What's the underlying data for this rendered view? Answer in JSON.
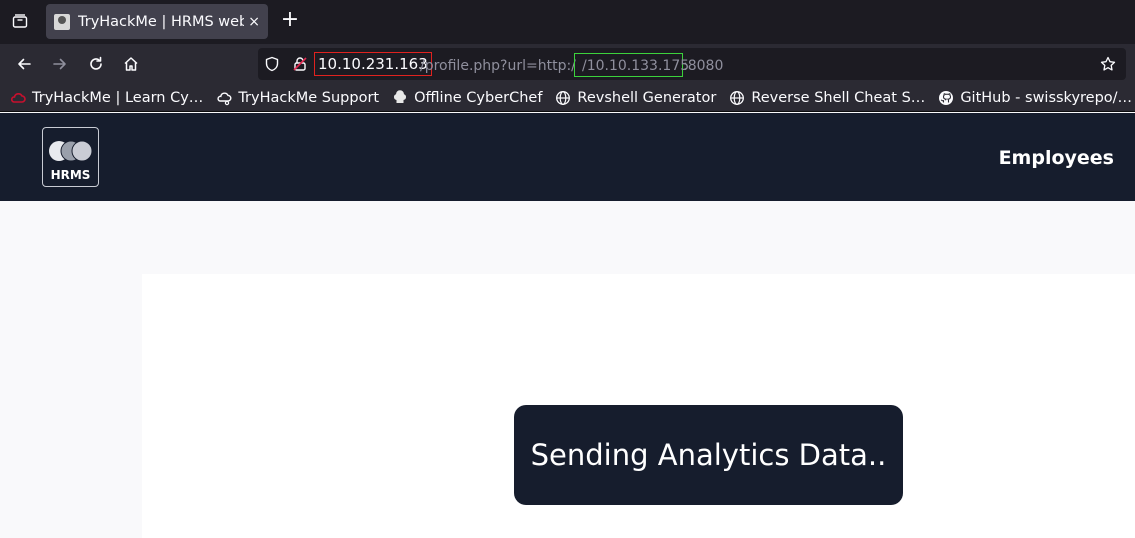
{
  "browser": {
    "tab": {
      "title": "TryHackMe | HRMS web a",
      "close": "×"
    },
    "new_tab": "+",
    "url": {
      "host": "10.10.231.163",
      "path": "/profile.php?url=http:/",
      "ip": "/10.10.133.175",
      "port": ":8080"
    },
    "bookmarks": [
      {
        "label": "TryHackMe | Learn Cy…",
        "icon": "thm-cloud-icon"
      },
      {
        "label": "TryHackMe Support",
        "icon": "support-cloud-icon"
      },
      {
        "label": "Offline CyberChef",
        "icon": "chef-hat-icon"
      },
      {
        "label": "Revshell Generator",
        "icon": "globe-icon"
      },
      {
        "label": "Reverse Shell Cheat S…",
        "icon": "globe-icon"
      },
      {
        "label": "GitHub - swisskyrepo/…",
        "icon": "github-icon"
      }
    ]
  },
  "site": {
    "logo_text": "HRMS",
    "nav": {
      "employees": "Employees"
    },
    "toast": "Sending Analytics Data.."
  }
}
